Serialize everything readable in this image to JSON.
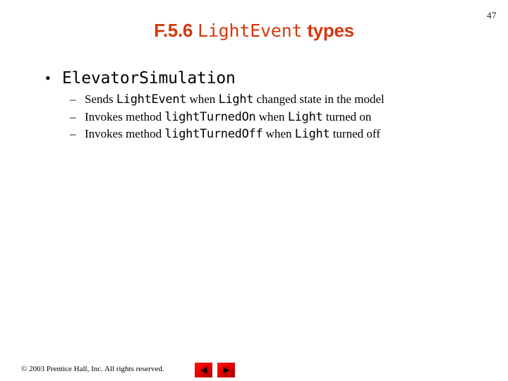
{
  "slide": {
    "page_number": "47",
    "background_color": "#ffffff",
    "accent_color": "#d4380d",
    "title": {
      "parts": [
        {
          "text": "F.5.6 ",
          "style": "bold"
        },
        {
          "text": "LightEvent",
          "style": "code"
        },
        {
          "text": " types",
          "style": "bold"
        }
      ],
      "plain": "F.5.6 LightEvent types"
    },
    "bullets": [
      {
        "level": 1,
        "marker": "•",
        "text": "ElevatorSimulation",
        "style": "code"
      }
    ],
    "sub_bullets": [
      {
        "marker": "–",
        "segments": [
          {
            "text": "Sends ",
            "style": "text"
          },
          {
            "text": "LightEvent",
            "style": "code"
          },
          {
            "text": " when ",
            "style": "text"
          },
          {
            "text": "Light",
            "style": "code"
          },
          {
            "text": " changed state in the model",
            "style": "text"
          }
        ],
        "plain": "Sends LightEvent when Light changed state in the model"
      },
      {
        "marker": "–",
        "segments": [
          {
            "text": "Invokes method ",
            "style": "text"
          },
          {
            "text": "lightTurnedOn",
            "style": "code"
          },
          {
            "text": " when ",
            "style": "text"
          },
          {
            "text": "Light",
            "style": "code"
          },
          {
            "text": " turned on",
            "style": "text"
          }
        ],
        "plain": "Invokes method lightTurnedOn when Light turned on"
      },
      {
        "marker": "–",
        "segments": [
          {
            "text": "Invokes method ",
            "style": "text"
          },
          {
            "text": "lightTurnedOff",
            "style": "code"
          },
          {
            "text": " when ",
            "style": "text"
          },
          {
            "text": "Light",
            "style": "code"
          },
          {
            "text": " turned off",
            "style": "text"
          }
        ],
        "plain": "Invokes method lightTurnedOff when Light turned off"
      }
    ],
    "footer": {
      "copyright": "© 2003 Prentice Hall, Inc.  All rights reserved.",
      "nav": [
        {
          "name": "previous-slide-button",
          "icon": "triangle-left-icon",
          "label": "Previous"
        },
        {
          "name": "next-slide-button",
          "icon": "triangle-right-icon",
          "label": "Next"
        }
      ],
      "button_color": "#e60000"
    }
  }
}
